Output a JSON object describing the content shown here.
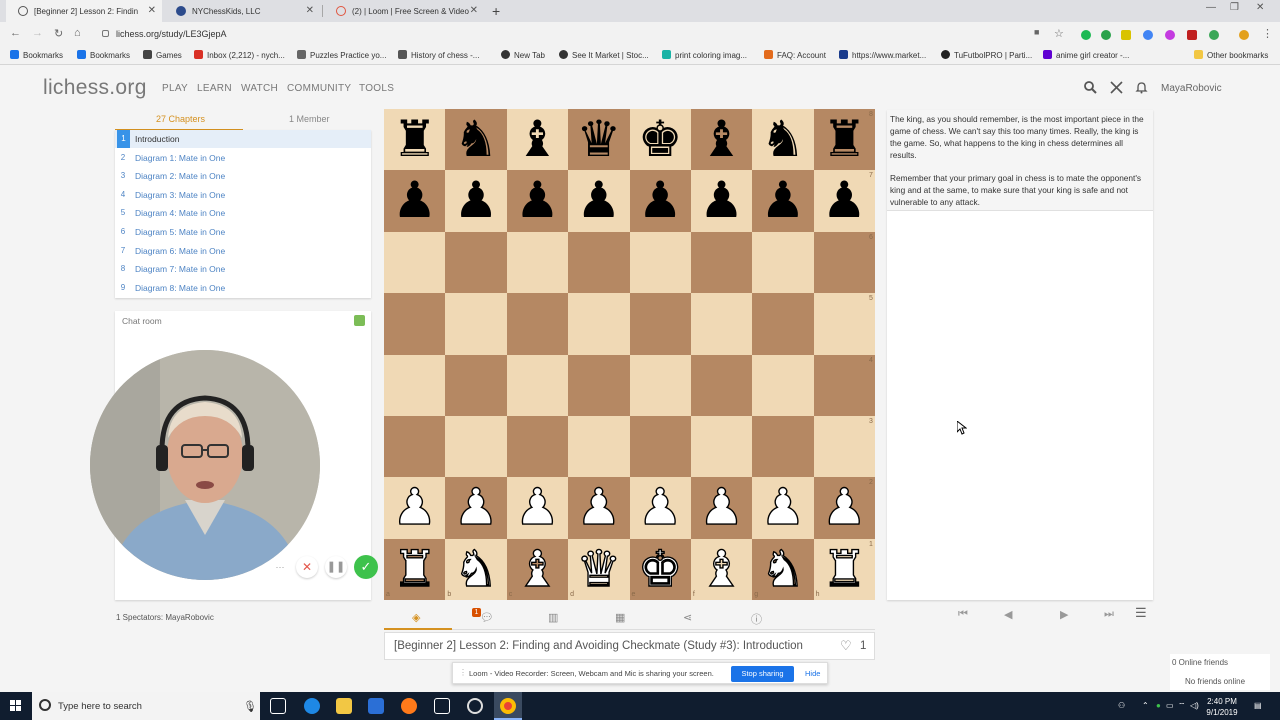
{
  "browser": {
    "tabs": [
      {
        "title": "[Beginner 2] Lesson 2: Findin",
        "active": true
      },
      {
        "title": "NYChessKids, LLC",
        "active": false
      },
      {
        "title": "(2) | Loom | Free Screen & Video",
        "active": false
      }
    ],
    "url": "lichess.org/study/LE3GjepA",
    "bookmarks": [
      "Bookmarks",
      "Bookmarks",
      "Games",
      "Inbox (2,212) - nych...",
      "Puzzles Practice yo...",
      "History of chess -...",
      "New Tab",
      "See It Market | Stoc...",
      "print coloring imag...",
      "FAQ: Account",
      "https://www.market...",
      "TuFutbolPRO | Parti...",
      "anime girl creator -...",
      "Other bookmarks"
    ]
  },
  "site": {
    "logo": "lichess.org",
    "nav": [
      "PLAY",
      "LEARN",
      "WATCH",
      "COMMUNITY",
      "TOOLS"
    ],
    "username": "MayaRobovic"
  },
  "chapters": {
    "tab_chapters": "27 Chapters",
    "tab_members": "1 Member",
    "items": [
      {
        "num": "1",
        "label": "Introduction"
      },
      {
        "num": "2",
        "label": "Diagram 1: Mate in One"
      },
      {
        "num": "3",
        "label": "Diagram 2: Mate in One"
      },
      {
        "num": "4",
        "label": "Diagram 3: Mate in One"
      },
      {
        "num": "5",
        "label": "Diagram 4: Mate in One"
      },
      {
        "num": "6",
        "label": "Diagram 5: Mate in One"
      },
      {
        "num": "7",
        "label": "Diagram 6: Mate in One"
      },
      {
        "num": "8",
        "label": "Diagram 7: Mate in One"
      },
      {
        "num": "9",
        "label": "Diagram 8: Mate in One"
      }
    ]
  },
  "chat": {
    "title": "Chat room"
  },
  "spectators": "1 Spectators: MayaRobovic",
  "board": {
    "ranks": [
      [
        "bR",
        "bN",
        "bB",
        "bQ",
        "bK",
        "bB",
        "bN",
        "bR"
      ],
      [
        "bP",
        "bP",
        "bP",
        "bP",
        "bP",
        "bP",
        "bP",
        "bP"
      ],
      [
        "",
        "",
        "",
        "",
        "",
        "",
        "",
        ""
      ],
      [
        "",
        "",
        "",
        "",
        "",
        "",
        "",
        ""
      ],
      [
        "",
        "",
        "",
        "",
        "",
        "",
        "",
        ""
      ],
      [
        "",
        "",
        "",
        "",
        "",
        "",
        "",
        ""
      ],
      [
        "wP",
        "wP",
        "wP",
        "wP",
        "wP",
        "wP",
        "wP",
        "wP"
      ],
      [
        "wR",
        "wN",
        "wB",
        "wQ",
        "wK",
        "wB",
        "wN",
        "wR"
      ]
    ],
    "rank_labels": [
      "8",
      "7",
      "6",
      "5",
      "4",
      "3",
      "2",
      "1"
    ],
    "file_labels": [
      "a",
      "b",
      "c",
      "d",
      "e",
      "f",
      "g",
      "h"
    ]
  },
  "comment": {
    "para1": "The king, as you should remember, is the most important piece in the game of chess. We can't say this too many times. Really, the king is the game. So, what happens to the king in chess determines all results.",
    "para2": "Remember that your primary goal in chess is to mate the opponent's king and at the same, to make sure that your king is safe and not vulnerable to any attack."
  },
  "study": {
    "title": "[Beginner 2] Lesson 2: Finding and Avoiding Checkmate (Study #3): Introduction",
    "likes": "1",
    "notification_count": "1"
  },
  "loom": {
    "message": "Loom - Video Recorder: Screen, Webcam and Mic is sharing your screen.",
    "stop": "Stop sharing",
    "hide": "Hide"
  },
  "friends": {
    "online": "0 Online friends",
    "none": "No friends online"
  },
  "taskbar": {
    "search_placeholder": "Type here to search",
    "time": "2:40 PM",
    "date": "9/1/2019"
  }
}
